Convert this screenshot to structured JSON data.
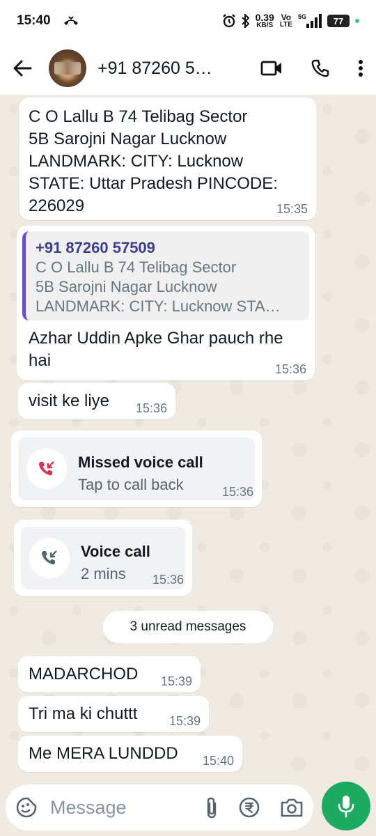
{
  "status_bar": {
    "time": "15:40",
    "speed_value": "0.39",
    "speed_unit": "KB/S",
    "volte_top": "Vo",
    "volte_bottom": "LTE",
    "network": "5G",
    "battery": "77"
  },
  "header": {
    "contact": "+91 87260 5…",
    "icons": [
      "back-arrow-icon",
      "video-call-icon",
      "phone-icon",
      "more-vert-icon"
    ]
  },
  "messages": {
    "m1": {
      "text": "C O  Lallu B 74 Telibag   Sector\n5B Sarojni Nagar Lucknow\nLANDMARK:  CITY: Lucknow\nSTATE: Uttar Pradesh PINCODE:\n226029",
      "time": "15:35"
    },
    "m2": {
      "quote_name": "+91 87260 57509",
      "quote_text": "C O  Lallu B 74 Telibag   Sector\n5B Sarojni Nagar Lucknow\nLANDMARK:  CITY: Lucknow STA…",
      "text": "Azhar Uddin Apke Ghar pauch rhe\nhai",
      "time": "15:36"
    },
    "m3": {
      "text": "visit ke liye",
      "time": "15:36"
    },
    "m4": {
      "title": "Missed voice call",
      "subtitle": "Tap to call back",
      "time": "15:36"
    },
    "m5": {
      "title": "Voice call",
      "subtitle": "2 mins",
      "time": "15:36"
    },
    "unread": "3 unread messages",
    "m6": {
      "text": "MADARCHOD",
      "time": "15:39"
    },
    "m7": {
      "text": "Tri ma ki chuttt",
      "time": "15:39"
    },
    "m8": {
      "text": "Me MERA LUNDDD",
      "time": "15:40"
    }
  },
  "composer": {
    "placeholder": "Message",
    "icons": [
      "emoji-icon",
      "attach-icon",
      "rupee-payment-icon",
      "camera-icon",
      "mic-icon"
    ]
  },
  "colors": {
    "chat_bg": "#efeae2",
    "bubble": "#ffffff",
    "quote_bar": "#6b4bd8",
    "missed_call": "#e02c4d",
    "mic_button": "#1daa61"
  }
}
